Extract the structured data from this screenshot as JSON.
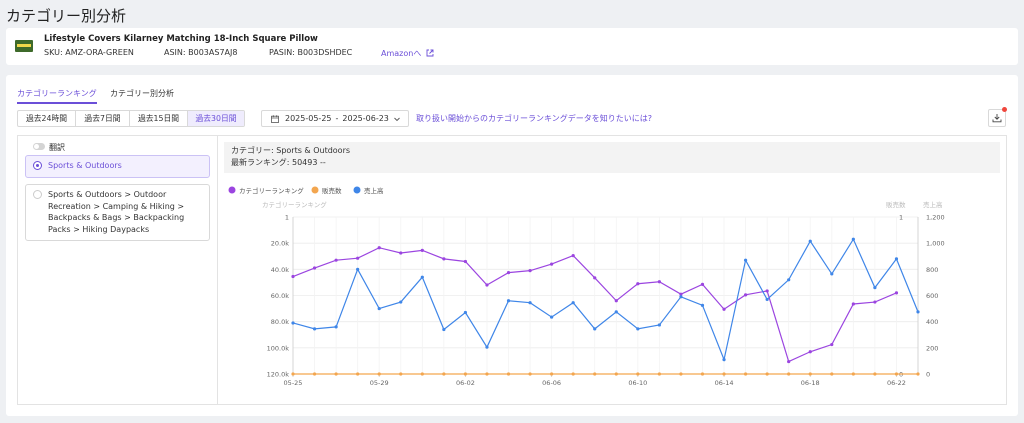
{
  "page": {
    "title": "カテゴリー別分析"
  },
  "product": {
    "name": "Lifestyle Covers Kilarney Matching 18-Inch Square Pillow",
    "sku_label": "SKU:",
    "sku": "AMZ-ORA-GREEN",
    "asin_label": "ASIN:",
    "asin": "B003AS7AJ8",
    "pasin_label": "PASIN:",
    "pasin": "B003DSHDEC",
    "amazon_link": "Amazonへ",
    "thumb_colors": [
      "#3e6a2a",
      "#f0d84a"
    ]
  },
  "tabs": [
    {
      "label": "カテゴリーランキング",
      "active": true
    },
    {
      "label": "カテゴリー別分析",
      "active": false
    }
  ],
  "ranges": [
    {
      "label": "過去24時間",
      "active": false
    },
    {
      "label": "過去7日間",
      "active": false
    },
    {
      "label": "過去15日間",
      "active": false
    },
    {
      "label": "過去30日間",
      "active": true
    }
  ],
  "date_range": {
    "start": "2025-05-25",
    "separator": "-",
    "end": "2025-06-23"
  },
  "question_link": "取り扱い開始からのカテゴリーランキングデータを知りたいには?",
  "toggle": {
    "label": "翻訳",
    "on": false
  },
  "category_options": [
    {
      "label": "Sports & Outdoors",
      "selected": true
    },
    {
      "label": "Sports & Outdoors > Outdoor Recreation > Camping & Hiking > Backpacks & Bags > Backpacking Packs > Hiking Daypacks",
      "selected": false
    }
  ],
  "info": {
    "category_line": "カテゴリー: Sports & Outdoors",
    "rank_line": "最新ランキング: 50493  --"
  },
  "colors": {
    "accent": "#6b4fd8",
    "ranking": "#9b45e0",
    "units": "#f3a64f",
    "sales": "#3f86e8"
  },
  "chart_data": {
    "type": "line",
    "legend_position": "top-left",
    "x": [
      "05-25",
      "05-26",
      "05-27",
      "05-28",
      "05-29",
      "05-30",
      "05-31",
      "06-01",
      "06-02",
      "06-03",
      "06-04",
      "06-05",
      "06-06",
      "06-07",
      "06-08",
      "06-09",
      "06-10",
      "06-11",
      "06-12",
      "06-13",
      "06-14",
      "06-15",
      "06-16",
      "06-17",
      "06-18",
      "06-19",
      "06-20",
      "06-21",
      "06-22",
      "06-23"
    ],
    "x_ticks": [
      "05-25",
      "05-29",
      "06-02",
      "06-06",
      "06-10",
      "06-14",
      "06-18",
      "06-22"
    ],
    "left_axis": {
      "label": "カテゴリーランキング",
      "ticks": [
        "1",
        "20.0k",
        "40.0k",
        "60.0k",
        "80.0k",
        "100.0k",
        "120.0k"
      ],
      "range": [
        1,
        120000
      ],
      "inverted": true
    },
    "right_axis_1": {
      "label": "販売数",
      "ticks": [
        "1",
        "0"
      ],
      "range": [
        0,
        1
      ]
    },
    "right_axis_2": {
      "label": "売上高",
      "ticks": [
        "1,200",
        "1,000",
        "800",
        "600",
        "400",
        "200",
        "0"
      ],
      "range": [
        0,
        1200
      ]
    },
    "series": [
      {
        "name": "カテゴリーランキング",
        "axis": "left",
        "values": [
          45500,
          39000,
          33000,
          31500,
          23500,
          27500,
          25500,
          32000,
          34000,
          52000,
          42500,
          41000,
          36000,
          29500,
          46500,
          64000,
          51000,
          49500,
          59000,
          51500,
          70500,
          59500,
          56500,
          110500,
          103000,
          97500,
          66500,
          65000,
          58000,
          null
        ]
      },
      {
        "name": "販売数",
        "axis": "right1",
        "values": [
          0,
          0,
          0,
          0,
          0,
          0,
          0,
          0,
          0,
          0,
          0,
          0,
          0,
          0,
          0,
          0,
          0,
          0,
          0,
          0,
          0,
          0,
          0,
          0,
          0,
          0,
          0,
          0,
          0,
          0
        ]
      },
      {
        "name": "売上高",
        "axis": "right2",
        "values": [
          390,
          345,
          360,
          800,
          500,
          550,
          740,
          340,
          470,
          205,
          560,
          545,
          435,
          545,
          345,
          475,
          345,
          375,
          590,
          525,
          110,
          870,
          570,
          720,
          1015,
          765,
          1030,
          660,
          880,
          475
        ]
      }
    ]
  }
}
